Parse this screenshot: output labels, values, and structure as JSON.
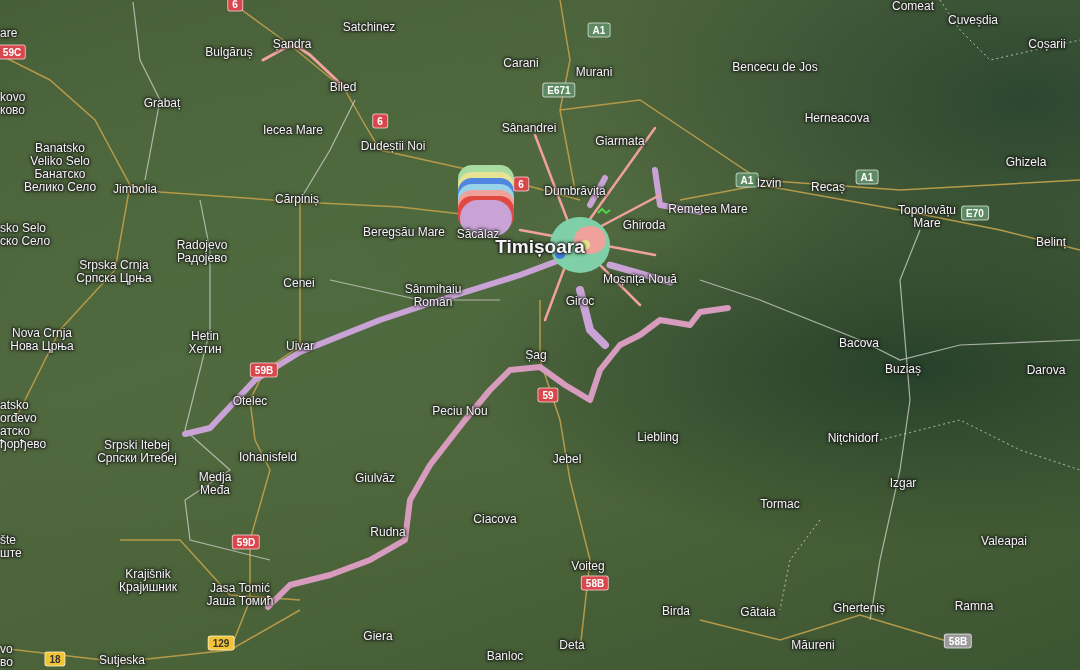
{
  "map": {
    "places": [
      {
        "kind": "village",
        "lines": [
          "Comeat"
        ]
      },
      {
        "kind": "village",
        "lines": [
          "are"
        ]
      },
      {
        "kind": "village",
        "lines": [
          "Satchinez"
        ]
      },
      {
        "kind": "village",
        "lines": [
          "Cuveșdia"
        ]
      },
      {
        "kind": "village",
        "lines": [
          "Bulgăruș"
        ]
      },
      {
        "kind": "village",
        "lines": [
          "Șandra"
        ]
      },
      {
        "kind": "village",
        "lines": [
          "Coșarii"
        ]
      },
      {
        "kind": "village",
        "lines": [
          "Carani"
        ]
      },
      {
        "kind": "village",
        "lines": [
          "Bencecu de Jos"
        ]
      },
      {
        "kind": "village",
        "lines": [
          "Murani"
        ]
      },
      {
        "kind": "village",
        "lines": [
          "kovo",
          "ково"
        ]
      },
      {
        "kind": "village",
        "lines": [
          "Biled"
        ]
      },
      {
        "kind": "village",
        "lines": [
          "Grabaț"
        ]
      },
      {
        "kind": "village",
        "lines": [
          "Iecea Mare"
        ]
      },
      {
        "kind": "village",
        "lines": [
          "Sânandrei"
        ]
      },
      {
        "kind": "village",
        "lines": [
          "Herneacova"
        ]
      },
      {
        "kind": "village",
        "lines": [
          "Banatsko",
          "Veliko Selo",
          "Банатско",
          "Велико Село"
        ]
      },
      {
        "kind": "village",
        "lines": [
          "Dudeștii Noi"
        ]
      },
      {
        "kind": "village",
        "lines": [
          "Giarmata"
        ]
      },
      {
        "kind": "village",
        "lines": [
          "Ghizela"
        ]
      },
      {
        "kind": "village",
        "lines": [
          "Jimbolia"
        ]
      },
      {
        "kind": "village",
        "lines": [
          "Cărpiniș"
        ]
      },
      {
        "kind": "village",
        "lines": [
          "Dumbrăvița"
        ]
      },
      {
        "kind": "village",
        "lines": [
          "Izvin"
        ]
      },
      {
        "kind": "village",
        "lines": [
          "Recaș"
        ]
      },
      {
        "kind": "village",
        "lines": [
          "sko Selo",
          "ско Село"
        ]
      },
      {
        "kind": "village",
        "lines": [
          "Radojevo",
          "Радојево"
        ]
      },
      {
        "kind": "village",
        "lines": [
          "Beregsău Mare"
        ]
      },
      {
        "kind": "village",
        "lines": [
          "Săcălaz"
        ]
      },
      {
        "kind": "village",
        "lines": [
          "Ghiroda"
        ]
      },
      {
        "kind": "village",
        "lines": [
          "Remetea Mare"
        ]
      },
      {
        "kind": "village",
        "lines": [
          "Topolovățu",
          "Mare"
        ]
      },
      {
        "kind": "city",
        "lines": [
          "Timișoara"
        ]
      },
      {
        "kind": "village",
        "lines": [
          "Belinț"
        ]
      },
      {
        "kind": "village",
        "lines": [
          "Srpska Crnja",
          "Српска Црња"
        ]
      },
      {
        "kind": "village",
        "lines": [
          "Cenei"
        ]
      },
      {
        "kind": "village",
        "lines": [
          "Sânmihaiu",
          "Român"
        ]
      },
      {
        "kind": "village",
        "lines": [
          "Moșnița Nouă"
        ]
      },
      {
        "kind": "village",
        "lines": [
          "Giroc"
        ]
      },
      {
        "kind": "village",
        "lines": [
          "Nova Crnja",
          "Нова Црња"
        ]
      },
      {
        "kind": "village",
        "lines": [
          "Hetin",
          "Хетин"
        ]
      },
      {
        "kind": "village",
        "lines": [
          "Uivar"
        ]
      },
      {
        "kind": "village",
        "lines": [
          "Șag"
        ]
      },
      {
        "kind": "village",
        "lines": [
          "Bacova"
        ]
      },
      {
        "kind": "village",
        "lines": [
          "Buziaș"
        ]
      },
      {
        "kind": "village",
        "lines": [
          "Darova"
        ]
      },
      {
        "kind": "village",
        "lines": [
          "atsko",
          "orđevo",
          "атско",
          "ђорђево"
        ]
      },
      {
        "kind": "village",
        "lines": [
          "Otelec"
        ]
      },
      {
        "kind": "village",
        "lines": [
          "Peciu Nou"
        ]
      },
      {
        "kind": "village",
        "lines": [
          "Srpski Itebej",
          "Српски Итебеј"
        ]
      },
      {
        "kind": "village",
        "lines": [
          "Iohanisfeld"
        ]
      },
      {
        "kind": "village",
        "lines": [
          "Jebel"
        ]
      },
      {
        "kind": "village",
        "lines": [
          "Liebling"
        ]
      },
      {
        "kind": "village",
        "lines": [
          "Nițchidorf"
        ]
      },
      {
        "kind": "village",
        "lines": [
          "Medja",
          "Međa"
        ]
      },
      {
        "kind": "village",
        "lines": [
          "Giulvăz"
        ]
      },
      {
        "kind": "village",
        "lines": [
          "Izgar"
        ]
      },
      {
        "kind": "village",
        "lines": [
          "Tormac"
        ]
      },
      {
        "kind": "village",
        "lines": [
          "šte",
          "ште"
        ]
      },
      {
        "kind": "village",
        "lines": [
          "Rudna"
        ]
      },
      {
        "kind": "village",
        "lines": [
          "Ciacova"
        ]
      },
      {
        "kind": "village",
        "lines": [
          "Valeapai"
        ]
      },
      {
        "kind": "village",
        "lines": [
          "Krajišnik",
          "Крајишник"
        ]
      },
      {
        "kind": "village",
        "lines": [
          "Voiteg"
        ]
      },
      {
        "kind": "village",
        "lines": [
          "Jasa Tomić",
          "Јаша Томић"
        ]
      },
      {
        "kind": "village",
        "lines": [
          "Birda"
        ]
      },
      {
        "kind": "village",
        "lines": [
          "Gătaia"
        ]
      },
      {
        "kind": "village",
        "lines": [
          "Gherteniș"
        ]
      },
      {
        "kind": "village",
        "lines": [
          "Ramna"
        ]
      },
      {
        "kind": "village",
        "lines": [
          "vo",
          "во"
        ]
      },
      {
        "kind": "village",
        "lines": [
          "Sutjeska"
        ]
      },
      {
        "kind": "village",
        "lines": [
          "Giera"
        ]
      },
      {
        "kind": "village",
        "lines": [
          "Banloc"
        ]
      },
      {
        "kind": "village",
        "lines": [
          "Deta"
        ]
      },
      {
        "kind": "village",
        "lines": [
          "Măureni"
        ]
      }
    ],
    "road_shields": [
      {
        "text": "6",
        "kind": "national"
      },
      {
        "text": "A1",
        "kind": "european"
      },
      {
        "text": "59C",
        "kind": "national"
      },
      {
        "text": "E671",
        "kind": "european"
      },
      {
        "text": "6",
        "kind": "national"
      },
      {
        "text": "A1",
        "kind": "european"
      },
      {
        "text": "A1",
        "kind": "european"
      },
      {
        "text": "6",
        "kind": "national"
      },
      {
        "text": "E70",
        "kind": "european"
      },
      {
        "text": "59B",
        "kind": "national"
      },
      {
        "text": "59",
        "kind": "national"
      },
      {
        "text": "59D",
        "kind": "national"
      },
      {
        "text": "58B",
        "kind": "national"
      },
      {
        "text": "58B",
        "kind": "county"
      },
      {
        "text": "129",
        "kind": "serbian"
      },
      {
        "text": "18",
        "kind": "serbian"
      }
    ]
  }
}
